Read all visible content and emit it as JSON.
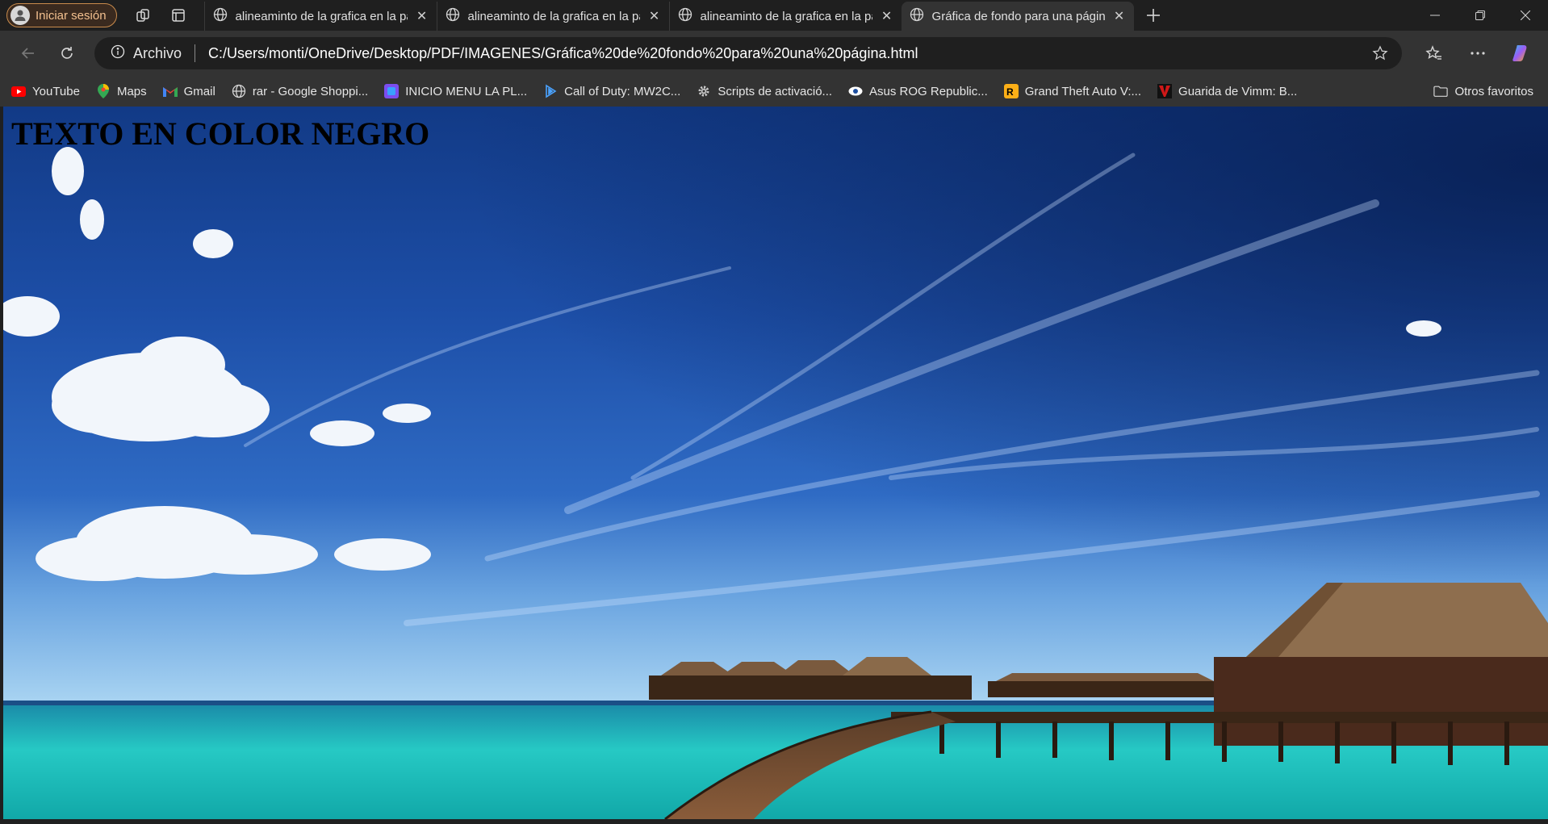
{
  "profile": {
    "label": "Iniciar sesión"
  },
  "tabs": [
    {
      "title": "alineaminto de la grafica en la pa",
      "active": false
    },
    {
      "title": "alineaminto de la grafica en la pa",
      "active": false
    },
    {
      "title": "alineaminto de la grafica en la pa",
      "active": false
    },
    {
      "title": "Gráfica de fondo para una página",
      "active": true
    }
  ],
  "address": {
    "info_label": "Archivo",
    "url": "C:/Users/monti/OneDrive/Desktop/PDF/IMAGENES/Gráfica%20de%20fondo%20para%20una%20página.html"
  },
  "bookmarks": [
    {
      "label": "YouTube",
      "icon": "youtube-icon"
    },
    {
      "label": "Maps",
      "icon": "maps-icon"
    },
    {
      "label": "Gmail",
      "icon": "gmail-icon"
    },
    {
      "label": "rar - Google Shoppi...",
      "icon": "globe-icon"
    },
    {
      "label": "INICIO MENU LA PL...",
      "icon": "app-icon"
    },
    {
      "label": "Call of Duty: MW2C...",
      "icon": "cod-icon"
    },
    {
      "label": "Scripts de activació...",
      "icon": "gear-icon"
    },
    {
      "label": "Asus ROG Republic...",
      "icon": "eye-icon"
    },
    {
      "label": "Grand Theft Auto V:...",
      "icon": "rockstar-icon"
    },
    {
      "label": "Guarida de Vimm: B...",
      "icon": "vimm-icon"
    }
  ],
  "other_favorites": "Otros favoritos",
  "page": {
    "heading": "TEXTO EN COLOR NEGRO"
  },
  "colors": {
    "profile_accent": "#c98b4c",
    "tab_active": "#333333",
    "background": "#1f1f1f"
  }
}
